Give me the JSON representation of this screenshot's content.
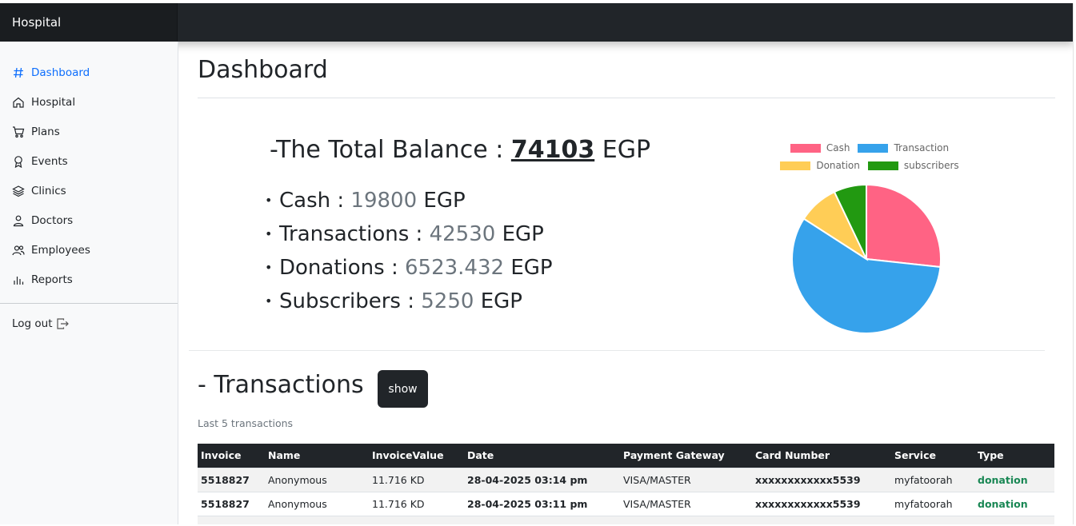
{
  "brand": "Hospital",
  "sidebar": {
    "items": [
      {
        "label": "Dashboard",
        "icon": "hash-icon",
        "active": true
      },
      {
        "label": "Hospital",
        "icon": "house-icon"
      },
      {
        "label": "Plans",
        "icon": "cart-icon"
      },
      {
        "label": "Events",
        "icon": "award-icon"
      },
      {
        "label": "Clinics",
        "icon": "layers-icon"
      },
      {
        "label": "Doctors",
        "icon": "person-icon"
      },
      {
        "label": "Employees",
        "icon": "people-icon"
      },
      {
        "label": "Reports",
        "icon": "bar-chart-icon"
      }
    ],
    "logout": "Log out"
  },
  "main": {
    "title": "Dashboard",
    "balance": {
      "prefix": "-The Total Balance :",
      "amount": "74103",
      "currency": "EGP"
    },
    "breakdown": [
      {
        "label": "Cash :",
        "value": "19800",
        "currency": "EGP"
      },
      {
        "label": "Transactions :",
        "value": "42530",
        "currency": "EGP"
      },
      {
        "label": "Donations :",
        "value": "6523.432",
        "currency": "EGP"
      },
      {
        "label": "Subscribers :",
        "value": "5250",
        "currency": "EGP"
      }
    ]
  },
  "chart_data": {
    "type": "pie",
    "categories": [
      "Cash",
      "Transaction",
      "Donation",
      "subscribers"
    ],
    "values": [
      19800,
      42530,
      6523.432,
      5250
    ],
    "colors": [
      "#ff6384",
      "#36a2eb",
      "#ffcd56",
      "#229911"
    ],
    "legend": "top"
  },
  "transactions": {
    "title": "- Transactions",
    "show_label": "show",
    "subtitle": "Last 5 transactions",
    "columns": [
      "Invoice",
      "Name",
      "InvoiceValue",
      "Date",
      "Payment Gateway",
      "Card Number",
      "Service",
      "Type"
    ],
    "rows": [
      [
        "5518827",
        "Anonymous",
        "11.716 KD",
        "28-04-2025 03:14 pm",
        "VISA/MASTER",
        "xxxxxxxxxxxx5539",
        "myfatoorah",
        "donation"
      ],
      [
        "5518827",
        "Anonymous",
        "11.716 KD",
        "28-04-2025 03:11 pm",
        "VISA/MASTER",
        "xxxxxxxxxxxx5539",
        "myfatoorah",
        "donation"
      ]
    ]
  },
  "accent_color": "#0d6efd",
  "success_color": "#198754"
}
